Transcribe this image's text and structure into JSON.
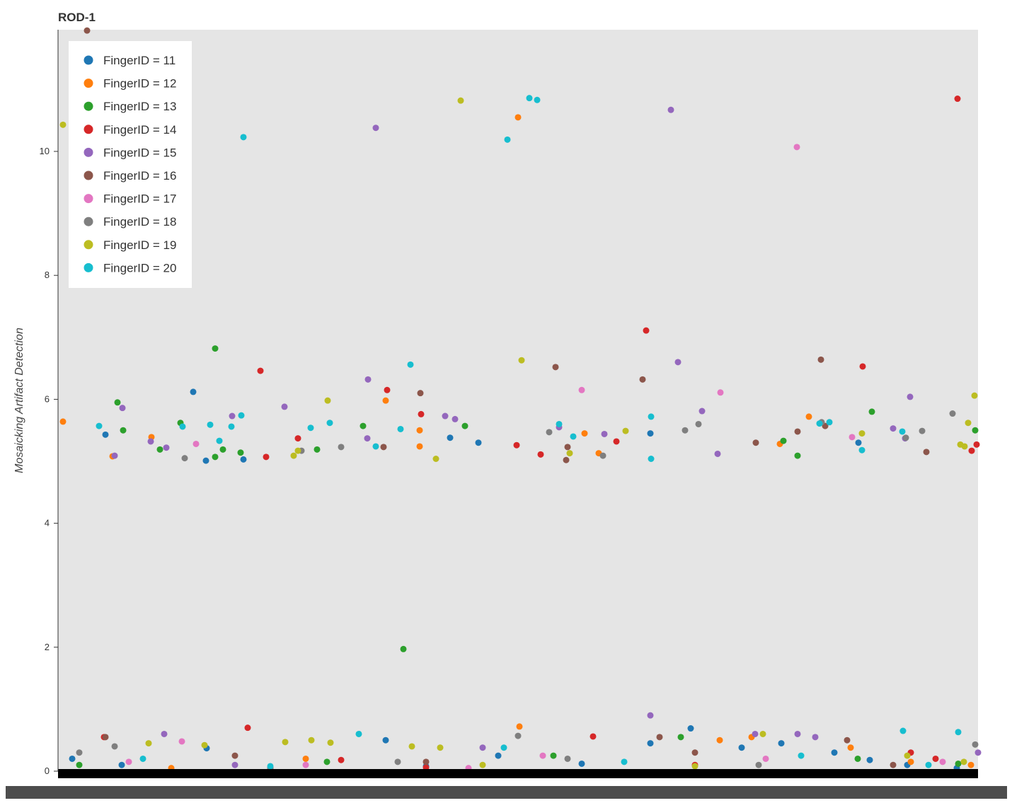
{
  "chart_data": {
    "type": "scatter",
    "title": "ROD-1",
    "xlabel": "",
    "ylabel": "Mosaicking Artifact Detection",
    "xlim": [
      0,
      1300
    ],
    "ylim": [
      0,
      12
    ],
    "yticks": [
      0,
      2,
      4,
      6,
      8,
      10
    ],
    "yticklabels": [
      "0",
      "2",
      "4",
      "6",
      "8",
      "10"
    ],
    "grid": false,
    "legend_position": "top-left",
    "background": "#e5e5e5",
    "series": [
      {
        "name": "FingerID = 11",
        "color": "#1f77b4",
        "points": [
          [
            67,
            5.43
          ],
          [
            191,
            6.12
          ],
          [
            209,
            5.01
          ],
          [
            262,
            5.03
          ],
          [
            554,
            5.38
          ],
          [
            594,
            5.3
          ],
          [
            837,
            5.45
          ],
          [
            1131,
            5.3
          ],
          [
            894,
            0.69
          ],
          [
            837,
            0.45
          ],
          [
            20,
            0.2
          ],
          [
            90,
            0.1
          ],
          [
            210,
            0.37
          ],
          [
            463,
            0.5
          ],
          [
            622,
            0.25
          ],
          [
            740,
            0.12
          ],
          [
            966,
            0.38
          ],
          [
            1022,
            0.45
          ],
          [
            1097,
            0.3
          ],
          [
            1147,
            0.18
          ],
          [
            300,
            0.05
          ],
          [
            520,
            0.08
          ],
          [
            1200,
            0.1
          ],
          [
            1270,
            0.05
          ]
        ]
      },
      {
        "name": "FingerID = 12",
        "color": "#ff7f0e",
        "points": [
          [
            7,
            5.64
          ],
          [
            77,
            5.08
          ],
          [
            132,
            5.39
          ],
          [
            463,
            5.98
          ],
          [
            511,
            5.5
          ],
          [
            511,
            5.24
          ],
          [
            650,
            10.55
          ],
          [
            744,
            5.45
          ],
          [
            764,
            5.13
          ],
          [
            1020,
            5.28
          ],
          [
            1061,
            5.72
          ],
          [
            652,
            0.72
          ],
          [
            935,
            0.5
          ],
          [
            980,
            0.55
          ],
          [
            1120,
            0.38
          ],
          [
            1205,
            0.15
          ],
          [
            1290,
            0.1
          ],
          [
            350,
            0.2
          ],
          [
            160,
            0.05
          ]
        ]
      },
      {
        "name": "FingerID = 13",
        "color": "#2ca02c",
        "points": [
          [
            84,
            5.95
          ],
          [
            92,
            5.5
          ],
          [
            144,
            5.19
          ],
          [
            173,
            5.62
          ],
          [
            222,
            6.82
          ],
          [
            222,
            5.07
          ],
          [
            233,
            5.19
          ],
          [
            258,
            5.14
          ],
          [
            366,
            5.19
          ],
          [
            431,
            5.57
          ],
          [
            575,
            5.57
          ],
          [
            488,
            1.97
          ],
          [
            1025,
            5.33
          ],
          [
            1045,
            5.09
          ],
          [
            1150,
            5.8
          ],
          [
            1296,
            5.5
          ],
          [
            880,
            0.55
          ],
          [
            1130,
            0.2
          ],
          [
            30,
            0.1
          ],
          [
            380,
            0.15
          ],
          [
            700,
            0.25
          ],
          [
            1272,
            0.12
          ]
        ]
      },
      {
        "name": "FingerID = 14",
        "color": "#d62728",
        "points": [
          [
            286,
            6.46
          ],
          [
            294,
            5.07
          ],
          [
            339,
            5.37
          ],
          [
            465,
            6.15
          ],
          [
            513,
            5.76
          ],
          [
            648,
            5.26
          ],
          [
            682,
            5.11
          ],
          [
            789,
            5.32
          ],
          [
            831,
            7.11
          ],
          [
            1137,
            6.53
          ],
          [
            1271,
            10.85
          ],
          [
            1291,
            5.17
          ],
          [
            1298,
            5.27
          ],
          [
            268,
            0.7
          ],
          [
            65,
            0.55
          ],
          [
            756,
            0.56
          ],
          [
            1205,
            0.3
          ],
          [
            400,
            0.18
          ],
          [
            520,
            0.06
          ],
          [
            900,
            0.1
          ],
          [
            1240,
            0.2
          ]
        ]
      },
      {
        "name": "FingerID = 15",
        "color": "#9467bd",
        "points": [
          [
            91,
            5.86
          ],
          [
            80,
            5.09
          ],
          [
            131,
            5.32
          ],
          [
            153,
            5.22
          ],
          [
            246,
            5.73
          ],
          [
            320,
            5.88
          ],
          [
            438,
            6.32
          ],
          [
            437,
            5.37
          ],
          [
            449,
            10.38
          ],
          [
            547,
            5.73
          ],
          [
            561,
            5.68
          ],
          [
            708,
            5.55
          ],
          [
            772,
            5.44
          ],
          [
            866,
            10.67
          ],
          [
            876,
            6.6
          ],
          [
            910,
            5.81
          ],
          [
            932,
            5.12
          ],
          [
            1180,
            5.53
          ],
          [
            1197,
            5.37
          ],
          [
            1204,
            6.04
          ],
          [
            837,
            0.9
          ],
          [
            150,
            0.6
          ],
          [
            985,
            0.6
          ],
          [
            1045,
            0.6
          ],
          [
            1070,
            0.55
          ],
          [
            1300,
            0.3
          ],
          [
            600,
            0.38
          ],
          [
            250,
            0.1
          ]
        ]
      },
      {
        "name": "FingerID = 16",
        "color": "#8c564b",
        "points": [
          [
            41,
            11.95
          ],
          [
            460,
            5.23
          ],
          [
            512,
            6.1
          ],
          [
            703,
            6.52
          ],
          [
            718,
            5.02
          ],
          [
            720,
            5.23
          ],
          [
            826,
            6.32
          ],
          [
            986,
            5.3
          ],
          [
            1045,
            5.48
          ],
          [
            1078,
            6.64
          ],
          [
            1084,
            5.57
          ],
          [
            1227,
            5.15
          ],
          [
            67,
            0.55
          ],
          [
            850,
            0.55
          ],
          [
            1115,
            0.5
          ],
          [
            250,
            0.25
          ],
          [
            520,
            0.15
          ],
          [
            900,
            0.3
          ],
          [
            1180,
            0.1
          ]
        ]
      },
      {
        "name": "FingerID = 17",
        "color": "#e377c2",
        "points": [
          [
            195,
            5.28
          ],
          [
            740,
            6.15
          ],
          [
            936,
            6.11
          ],
          [
            1044,
            10.07
          ],
          [
            1122,
            5.39
          ],
          [
            175,
            0.48
          ],
          [
            685,
            0.25
          ],
          [
            100,
            0.15
          ],
          [
            350,
            0.1
          ],
          [
            580,
            0.05
          ],
          [
            1000,
            0.2
          ],
          [
            1250,
            0.15
          ]
        ]
      },
      {
        "name": "FingerID = 18",
        "color": "#7f7f7f",
        "points": [
          [
            179,
            5.05
          ],
          [
            344,
            5.17
          ],
          [
            400,
            5.23
          ],
          [
            694,
            5.47
          ],
          [
            770,
            5.09
          ],
          [
            886,
            5.5
          ],
          [
            905,
            5.6
          ],
          [
            1079,
            5.63
          ],
          [
            1221,
            5.49
          ],
          [
            1264,
            5.77
          ],
          [
            1198,
            5.38
          ],
          [
            650,
            0.57
          ],
          [
            80,
            0.4
          ],
          [
            30,
            0.3
          ],
          [
            1296,
            0.43
          ],
          [
            720,
            0.2
          ],
          [
            480,
            0.15
          ],
          [
            990,
            0.1
          ],
          [
            300,
            0.05
          ]
        ]
      },
      {
        "name": "FingerID = 19",
        "color": "#bcbd22",
        "points": [
          [
            7,
            10.43
          ],
          [
            333,
            5.09
          ],
          [
            339,
            5.17
          ],
          [
            381,
            5.98
          ],
          [
            534,
            5.04
          ],
          [
            569,
            10.82
          ],
          [
            655,
            6.63
          ],
          [
            723,
            5.13
          ],
          [
            802,
            5.49
          ],
          [
            1136,
            5.45
          ],
          [
            1275,
            5.27
          ],
          [
            1281,
            5.24
          ],
          [
            1286,
            5.62
          ],
          [
            1295,
            6.06
          ],
          [
            128,
            0.45
          ],
          [
            207,
            0.42
          ],
          [
            321,
            0.47
          ],
          [
            358,
            0.5
          ],
          [
            385,
            0.46
          ],
          [
            500,
            0.4
          ],
          [
            540,
            0.38
          ],
          [
            996,
            0.6
          ],
          [
            1200,
            0.25
          ],
          [
            1280,
            0.15
          ],
          [
            600,
            0.1
          ],
          [
            900,
            0.08
          ]
        ]
      },
      {
        "name": "FingerID = 20",
        "color": "#17becf",
        "points": [
          [
            58,
            5.57
          ],
          [
            176,
            5.56
          ],
          [
            215,
            5.59
          ],
          [
            228,
            5.33
          ],
          [
            245,
            5.56
          ],
          [
            259,
            5.74
          ],
          [
            262,
            10.23
          ],
          [
            357,
            5.54
          ],
          [
            384,
            5.62
          ],
          [
            449,
            5.24
          ],
          [
            484,
            5.52
          ],
          [
            498,
            6.56
          ],
          [
            635,
            10.19
          ],
          [
            666,
            10.86
          ],
          [
            677,
            10.83
          ],
          [
            708,
            5.6
          ],
          [
            728,
            5.4
          ],
          [
            838,
            5.72
          ],
          [
            838,
            5.04
          ],
          [
            1076,
            5.61
          ],
          [
            1090,
            5.63
          ],
          [
            1136,
            5.18
          ],
          [
            1193,
            5.48
          ],
          [
            425,
            0.6
          ],
          [
            1194,
            0.65
          ],
          [
            1272,
            0.63
          ],
          [
            630,
            0.38
          ],
          [
            120,
            0.2
          ],
          [
            800,
            0.15
          ],
          [
            1050,
            0.25
          ],
          [
            300,
            0.08
          ],
          [
            1230,
            0.1
          ]
        ]
      }
    ]
  }
}
